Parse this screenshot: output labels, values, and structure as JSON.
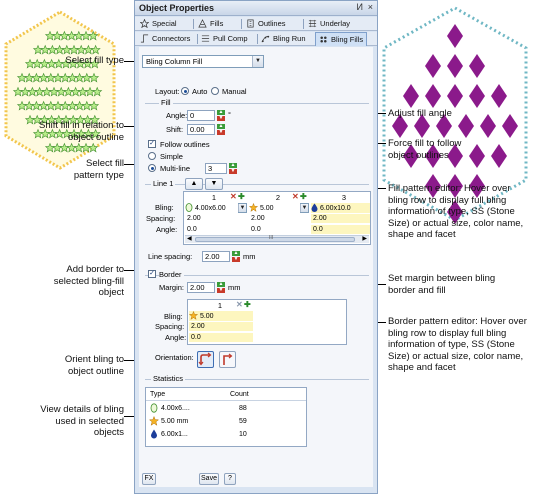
{
  "panel": {
    "title": "Object Properties",
    "pin_glyph": "И",
    "close_glyph": "×",
    "tabs_row1": [
      {
        "label": "Special",
        "icon": "star-icon"
      },
      {
        "label": "Fills",
        "icon": "fills-icon"
      },
      {
        "label": "Outlines",
        "icon": "outlines-icon"
      },
      {
        "label": "Underlay",
        "icon": "underlay-icon"
      }
    ],
    "tabs_row2": [
      {
        "label": "Connectors",
        "icon": "connectors-icon"
      },
      {
        "label": "Pull Comp",
        "icon": "pull-comp-icon"
      },
      {
        "label": "Bling Run",
        "icon": "bling-run-icon"
      },
      {
        "label": "Bling Fills",
        "icon": "bling-fills-icon",
        "active": true
      }
    ]
  },
  "fill_type": {
    "value": "Bling Column Fill"
  },
  "layout": {
    "label": "Layout:",
    "auto": "Auto",
    "manual": "Manual",
    "selected": "Auto"
  },
  "fill": {
    "title": "Fill",
    "angle_label": "Angle:",
    "angle_value": "0",
    "angle_unit": "°",
    "shift_label": "Shift:",
    "shift_value": "0.00",
    "follow_outlines": "Follow outlines",
    "simple": "Simple",
    "multiline": "Multi-line",
    "multiline_value": "3",
    "line_label": "Line 1"
  },
  "pattern_grid": {
    "columns": [
      "1",
      "2",
      "3"
    ],
    "row_labels": [
      "Bling:",
      "Spacing:",
      "Angle:"
    ],
    "bling": [
      "4.00x6.00",
      "5.00",
      "6.00x10.0"
    ],
    "spacing": [
      "2.00",
      "2.00",
      "2.00"
    ],
    "angle": [
      "0.0",
      "0.0",
      "0.0"
    ],
    "scroll_mark": "III"
  },
  "line_spacing": {
    "label": "Line spacing:",
    "value": "2.00",
    "unit": "mm"
  },
  "border": {
    "label": "Border",
    "margin_label": "Margin:",
    "margin_value": "2.00",
    "margin_unit": "mm",
    "grid": {
      "column": "1",
      "row_labels": [
        "Bling:",
        "Spacing:",
        "Angle:"
      ],
      "bling": "5.00",
      "spacing": "2.00",
      "angle": "0.0"
    }
  },
  "orientation": {
    "label": "Orientation:"
  },
  "statistics": {
    "title": "Statistics",
    "headers": [
      "Type",
      "Count"
    ],
    "rows": [
      {
        "type": "4.00x6....",
        "count": "88",
        "icon": "oval-bling-icon"
      },
      {
        "type": "5.00 mm",
        "count": "59",
        "icon": "star-bling-icon"
      },
      {
        "type": "6.00x1...",
        "count": "10",
        "icon": "drop-bling-icon"
      }
    ]
  },
  "footer": {
    "fx": "FX",
    "save": "Save",
    "help": "?"
  },
  "callouts": {
    "select_fill_type": "Select fill type",
    "shift_fill": "Shift fill in relation to object outline",
    "select_fill_pattern": "Select fill pattern type",
    "add_border": "Add border to selected bling-fill object",
    "orient_bling": "Orient bling to object outline",
    "view_details": "View details of bling used in selected objects",
    "adjust_angle": "Adjust fill angle",
    "force_fill": "Force fill to follow object outlines",
    "pattern_editor": "Fill pattern editor: Hover over bling row to display full bling information of type, SS (Stone Size) or actual size, color name, shape and facet",
    "set_margin": "Set margin between bling border and fill",
    "border_editor": "Border pattern editor: Hover over bling row to display full bling information of type, SS (Stone Size) or actual size, color name, shape and facet"
  },
  "colors": {
    "panel_bg": "#d9e4f2",
    "purple": "#8b1a8b",
    "green": "#7ed957",
    "teal": "#6fb7c4",
    "yellow": "#fdf6bf"
  }
}
